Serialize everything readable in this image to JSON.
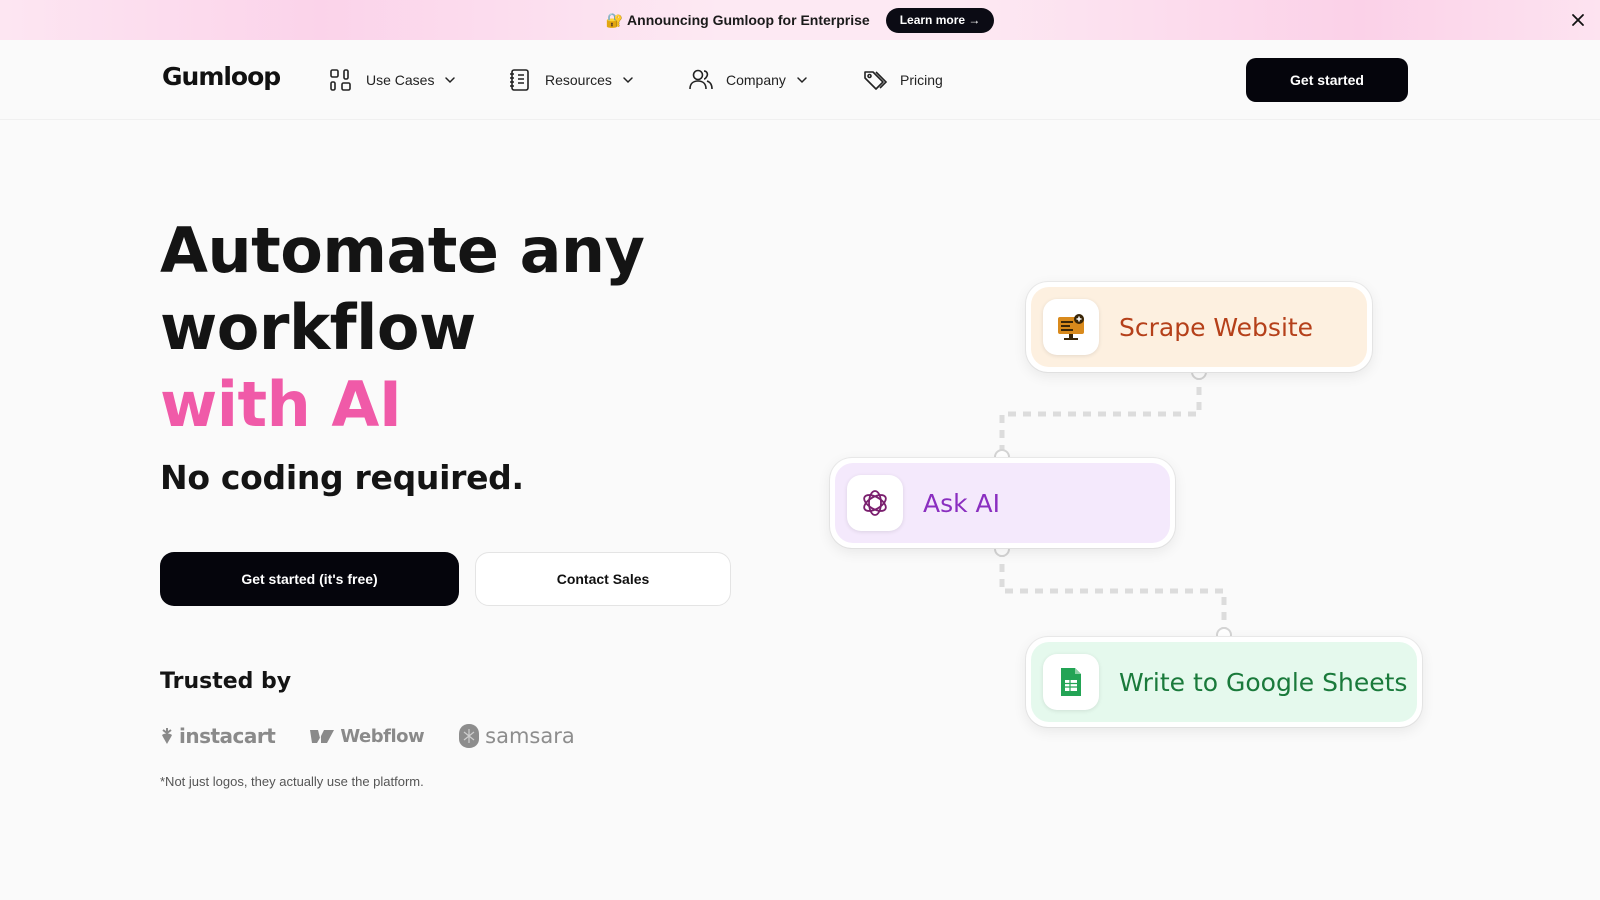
{
  "announcement": {
    "emoji": "🔐",
    "text": "Announcing Gumloop for Enterprise",
    "button_label": "Learn more →"
  },
  "nav": {
    "logo": "Gumloop",
    "items": [
      {
        "label": "Use Cases",
        "icon": "grid-shapes-icon",
        "has_dropdown": true
      },
      {
        "label": "Resources",
        "icon": "notebook-icon",
        "has_dropdown": true
      },
      {
        "label": "Company",
        "icon": "users-icon",
        "has_dropdown": true
      },
      {
        "label": "Pricing",
        "icon": "price-tags-icon",
        "has_dropdown": false
      }
    ],
    "cta_label": "Get started"
  },
  "hero": {
    "headline_line1": "Automate any",
    "headline_line2": "workflow",
    "headline_highlight": "with AI",
    "subheadline": "No coding required.",
    "primary_button": "Get started (it's free)",
    "secondary_button": "Contact Sales",
    "trusted_label": "Trusted by",
    "logos": [
      "instacart",
      "Webflow",
      "samsara"
    ],
    "footnote": "*Not just logos, they actually use the platform."
  },
  "flow": {
    "nodes": [
      {
        "label": "Scrape Website",
        "icon": "monitor-plus-icon"
      },
      {
        "label": "Ask AI",
        "icon": "openai-icon"
      },
      {
        "label": "Write to Google Sheets",
        "icon": "google-sheets-icon"
      }
    ]
  },
  "colors": {
    "accent_pink": "#f05aa8",
    "button_dark": "#05050c",
    "scrape_text": "#b5401a",
    "ask_ai_text": "#8a2ec0",
    "sheets_text": "#1a7a3b"
  }
}
